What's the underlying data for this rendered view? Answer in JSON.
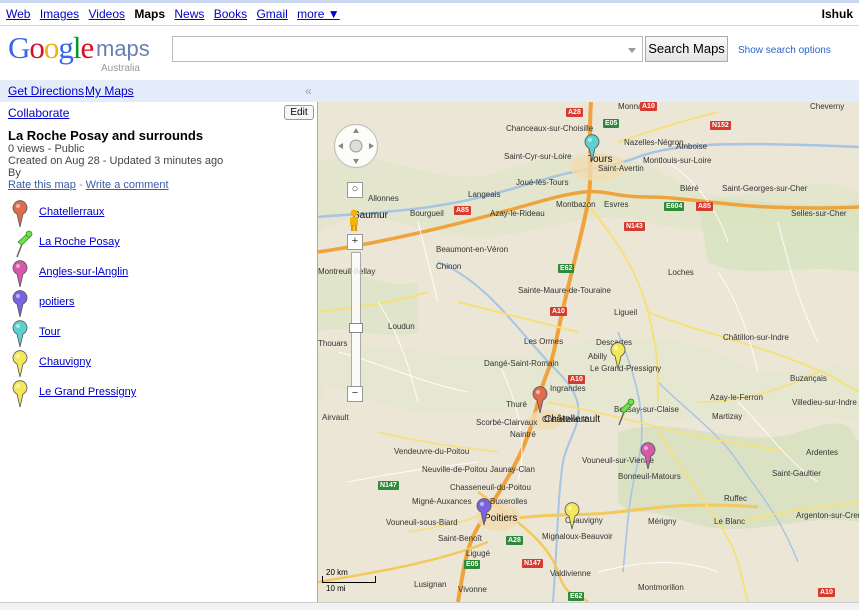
{
  "topnav": {
    "items": [
      "Web",
      "Images",
      "Videos",
      "Maps",
      "News",
      "Books",
      "Gmail",
      "more ▼"
    ],
    "user": "Ishuk"
  },
  "header": {
    "logo": "Google",
    "product": "maps",
    "region": "Australia",
    "search_value": "",
    "search_button": "Search Maps",
    "show_options": "Show search options"
  },
  "sidebar": {
    "get_directions": "Get Directions",
    "my_maps": "My Maps",
    "collapse": "«",
    "collaborate": "Collaborate",
    "edit": "Edit",
    "map_title": "La Roche Posay and surrounds",
    "views": "0 views - Public",
    "created": "Created on Aug 28 - Updated 3 minutes ago",
    "by": "By",
    "rate": "Rate this map",
    "dash": "-",
    "comment": "Write a comment",
    "placemarks": [
      {
        "label": "Chatellerraux",
        "color": "#e06c4f",
        "type": "balloon"
      },
      {
        "label": "La Roche Posay",
        "color": "#6fe04a",
        "type": "pushpin"
      },
      {
        "label": "Angles-sur-lAnglin",
        "color": "#d65aa8",
        "type": "balloon"
      },
      {
        "label": "poitiers",
        "color": "#7b62e0",
        "type": "balloon"
      },
      {
        "label": "Tour",
        "color": "#5dd0d0",
        "type": "balloon"
      },
      {
        "label": "Chauvigny",
        "color": "#f2e85a",
        "type": "balloon"
      },
      {
        "label": "Le Grand Pressigny",
        "color": "#f2e85a",
        "type": "balloon"
      }
    ]
  },
  "map": {
    "towns": [
      "Monnaie",
      "Cheverny",
      "Chanceaux-sur-Choisille",
      "Nazelles-Négron",
      "Amboise",
      "Saint-Cyr-sur-Loire",
      "Tours",
      "Saint-Avertin",
      "Montlouis-sur-Loire",
      "Langeais",
      "Joué-lès-Tours",
      "Bléré",
      "Saint-Georges-sur-Cher",
      "Allonnes",
      "Montbazon",
      "Esvres",
      "Saumur",
      "Bourgueil",
      "Azay-le-Rideau",
      "Selles-sur-Cher",
      "Beaumont-en-Véron",
      "Chinon",
      "Loches",
      "Montreuil-Bellay",
      "Sainte-Maure-de-Touraine",
      "Loudun",
      "Ligueil",
      "Châtillon-sur-Indre",
      "Thouars",
      "Les Ormes",
      "Descartes",
      "Abilly",
      "Le Grand-Pressigny",
      "Dangé-Saint-Romain",
      "Ingrandes",
      "Buzançais",
      "Thuré",
      "Châtellerault",
      "Airvault",
      "Naintré",
      "Scorbé-Clairvaux",
      "Vendeuvre-du-Poitou",
      "Neuville-de-Poitou",
      "Jaunay-Clan",
      "Chasseneuil-du-Poitou",
      "Migné-Auxances",
      "Buxerolles",
      "Poitiers",
      "Chauvigny",
      "Vouneuil-sous-Biard",
      "Saint-Benoît",
      "Mignaloux-Beauvoir",
      "Ligugé",
      "Valdivienne",
      "Lusignan",
      "Vivonne",
      "Montmorillon",
      "Le Blanc",
      "Ruffec",
      "Mérigny",
      "Argenton-sur-Creuse",
      "Saint-Gaultier",
      "Martizay",
      "Azay-le-Ferron",
      "Villedieu-sur-Indre",
      "Ardentes",
      "Vouneuil-sur-Vienne",
      "Bonneuil-Matours",
      "Bossay-sur-Claise",
      "Chatellerault"
    ],
    "roads": [
      "A10",
      "A28",
      "E05",
      "N152",
      "A85",
      "E604",
      "N143",
      "E62",
      "N147"
    ],
    "scale_km": "20 km",
    "scale_mi": "10 mi"
  }
}
